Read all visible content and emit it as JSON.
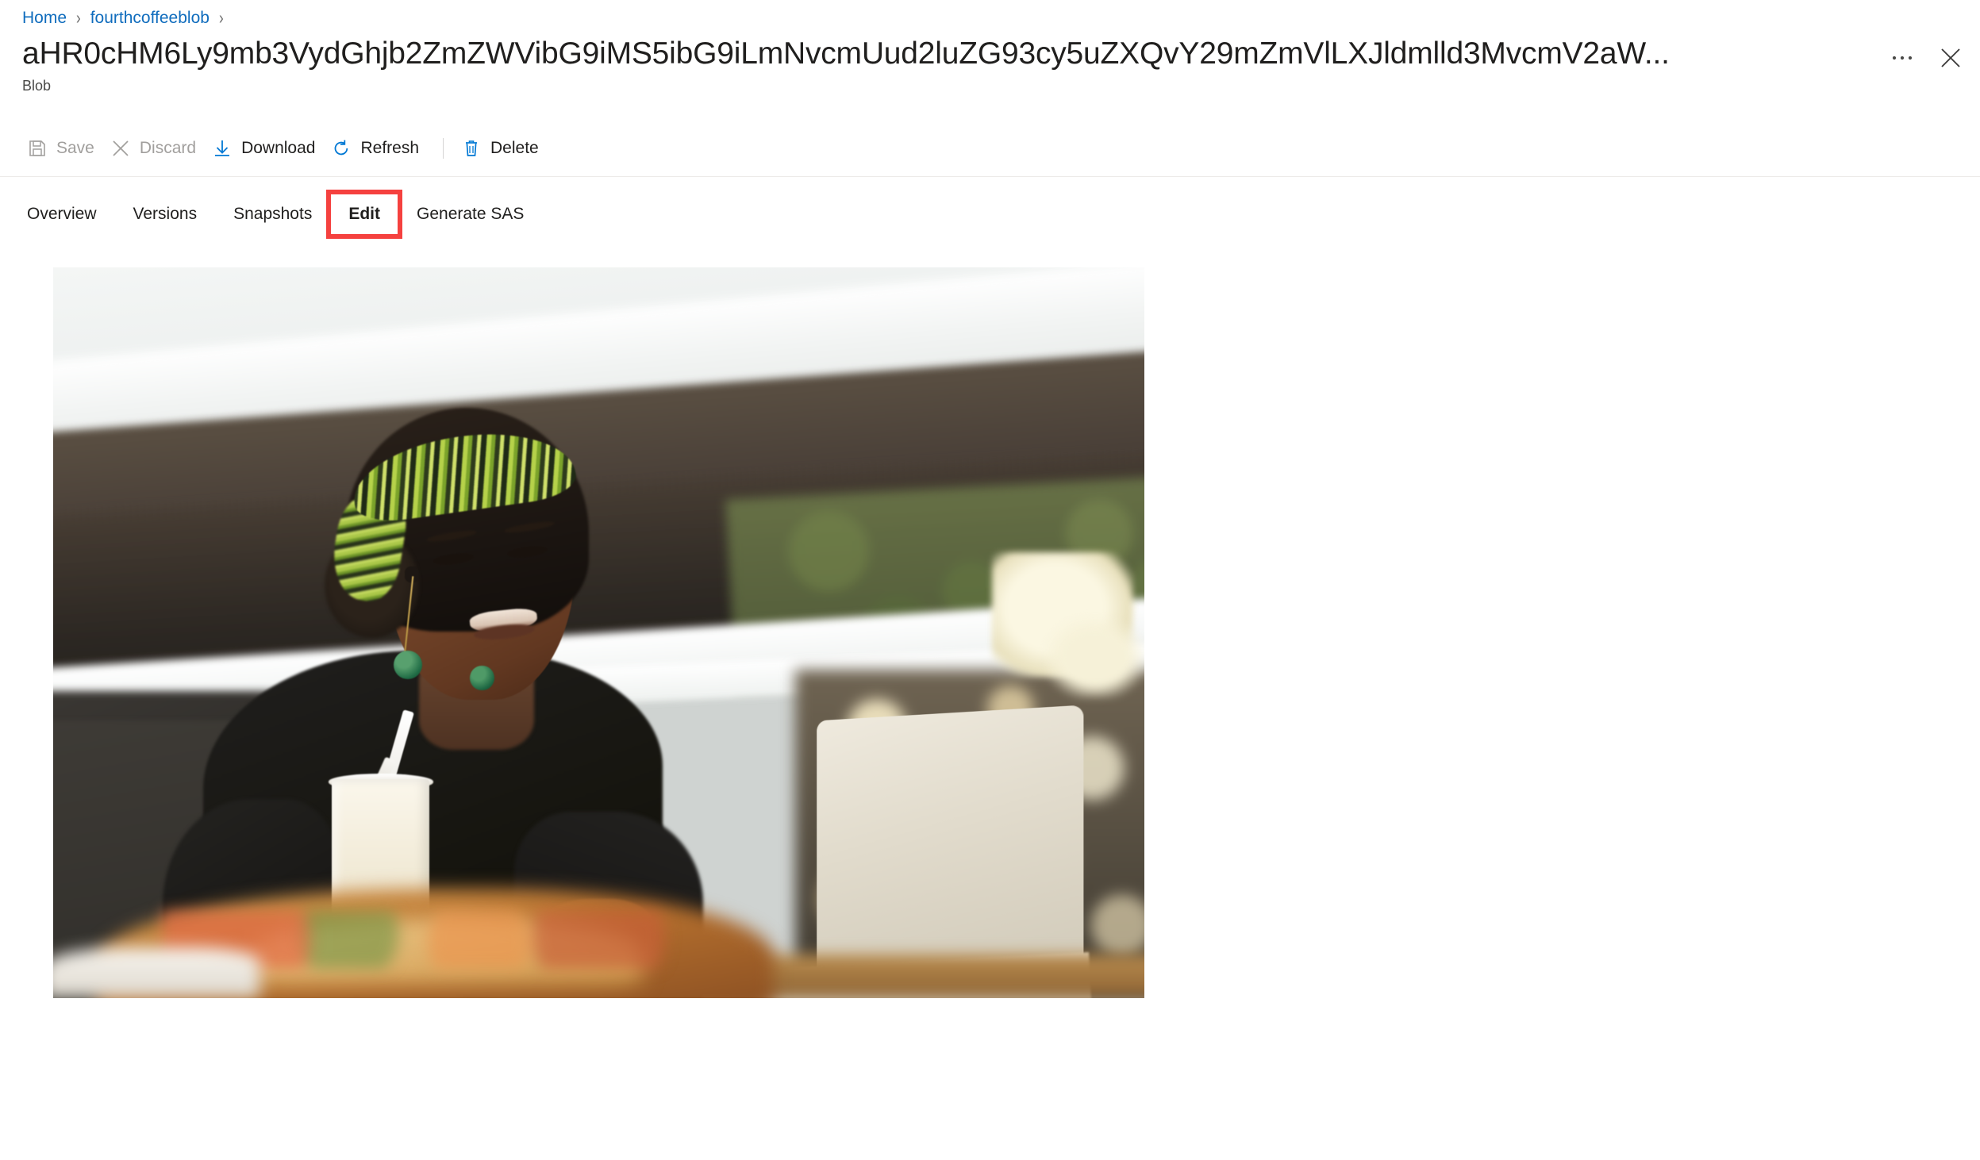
{
  "breadcrumb": {
    "items": [
      {
        "label": "Home",
        "link": true
      },
      {
        "label": "fourthcoffeeblob",
        "link": true
      }
    ],
    "separator": "›"
  },
  "header": {
    "title": "aHR0cHM6Ly9mb3VydGhjb2ZmZWVibG9iMS5ibG9iLmNvcmUud2luZG93cy5uZXQvY29mZmVlLXJldmlld3MvcmV2aW...",
    "subtitle": "Blob",
    "more_label": "•••",
    "close_label": "Close"
  },
  "toolbar": {
    "save_label": "Save",
    "discard_label": "Discard",
    "download_label": "Download",
    "refresh_label": "Refresh",
    "delete_label": "Delete"
  },
  "tabs": [
    {
      "label": "Overview"
    },
    {
      "label": "Versions"
    },
    {
      "label": "Snapshots"
    },
    {
      "label": "Edit"
    },
    {
      "label": "Generate SAS"
    }
  ],
  "preview": {
    "alt": "Woman with green patterned headband smiling while typing on a laptop at a cafe table with a smoothie"
  },
  "colors": {
    "link": "#0f6cbd",
    "icon_accent": "#0078d4",
    "text_primary": "#201f1e",
    "text_disabled": "#a19f9d",
    "annotation_highlight": "#f5413f",
    "divider": "#edebe9"
  }
}
